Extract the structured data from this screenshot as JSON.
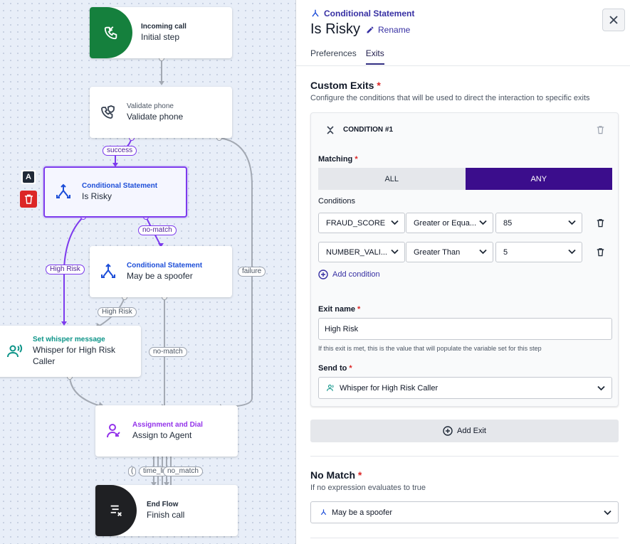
{
  "canvas": {
    "nodes": [
      {
        "type": "Incoming call",
        "name": "Initial step",
        "icon": "incoming-call-icon"
      },
      {
        "type": "Validate phone",
        "name": "Validate phone",
        "icon": "phone-shield-icon"
      },
      {
        "type": "Conditional Statement",
        "name": "Is Risky",
        "icon": "branch-icon"
      },
      {
        "type": "Conditional Statement",
        "name": "May be a spoofer",
        "icon": "branch-icon"
      },
      {
        "type": "Set whisper message",
        "name": "Whisper for High Risk Caller",
        "icon": "whisper-icon"
      },
      {
        "type": "Assignment and Dial",
        "name": "Assign to Agent",
        "icon": "assign-agent-icon"
      },
      {
        "type": "End Flow",
        "name": "Finish call",
        "icon": "end-flow-icon"
      }
    ],
    "edge_labels": {
      "success": "success",
      "no_match_1": "no-match",
      "high_risk_1": "High Risk",
      "failure": "failure",
      "high_risk_2": "High Risk",
      "no_match_2": "no-match",
      "time_limit": "time_li",
      "no_match_3": "no_match",
      "clipped": "("
    },
    "node_tools": {
      "label_icon": "A"
    }
  },
  "panel": {
    "type_label": "Conditional Statement",
    "title": "Is Risky",
    "rename_label": "Rename",
    "tabs": [
      "Preferences",
      "Exits"
    ],
    "active_tab": "Exits",
    "custom_exits": {
      "title": "Custom Exits",
      "required_mark": "*",
      "description": "Configure the conditions that will be used to direct the interaction to specific exits",
      "condition": {
        "title": "CONDITION #1",
        "matching_label": "Matching",
        "matching_options": [
          "ALL",
          "ANY"
        ],
        "matching_selected": "ANY",
        "conditions_label": "Conditions",
        "rows": [
          {
            "field": "FRAUD_SCORE",
            "operator": "Greater or Equa...",
            "value": "85"
          },
          {
            "field": "NUMBER_VALI...",
            "operator": "Greater Than",
            "value": "5"
          }
        ],
        "add_condition_label": "Add condition",
        "exit_name_label": "Exit name",
        "exit_name_value": "High Risk",
        "exit_name_hint": "If this exit is met, this is the value that will populate the variable set for this step",
        "send_to_label": "Send to",
        "send_to_value": "Whisper for High Risk Caller"
      },
      "add_exit_label": "Add Exit"
    },
    "no_match": {
      "title": "No Match",
      "required_mark": "*",
      "description": "If no expression evaluates to true",
      "value": "May be a spoofer"
    }
  },
  "colors": {
    "accent": "#3b0d8c",
    "selected_border": "#7c3aed",
    "incoming_green": "#15803d",
    "end_dark": "#1f2023",
    "delete_red": "#dc2626",
    "conditional_blue": "#1d4ed8",
    "whisper_teal": "#0d9488",
    "assign_purple": "#9333ea"
  }
}
